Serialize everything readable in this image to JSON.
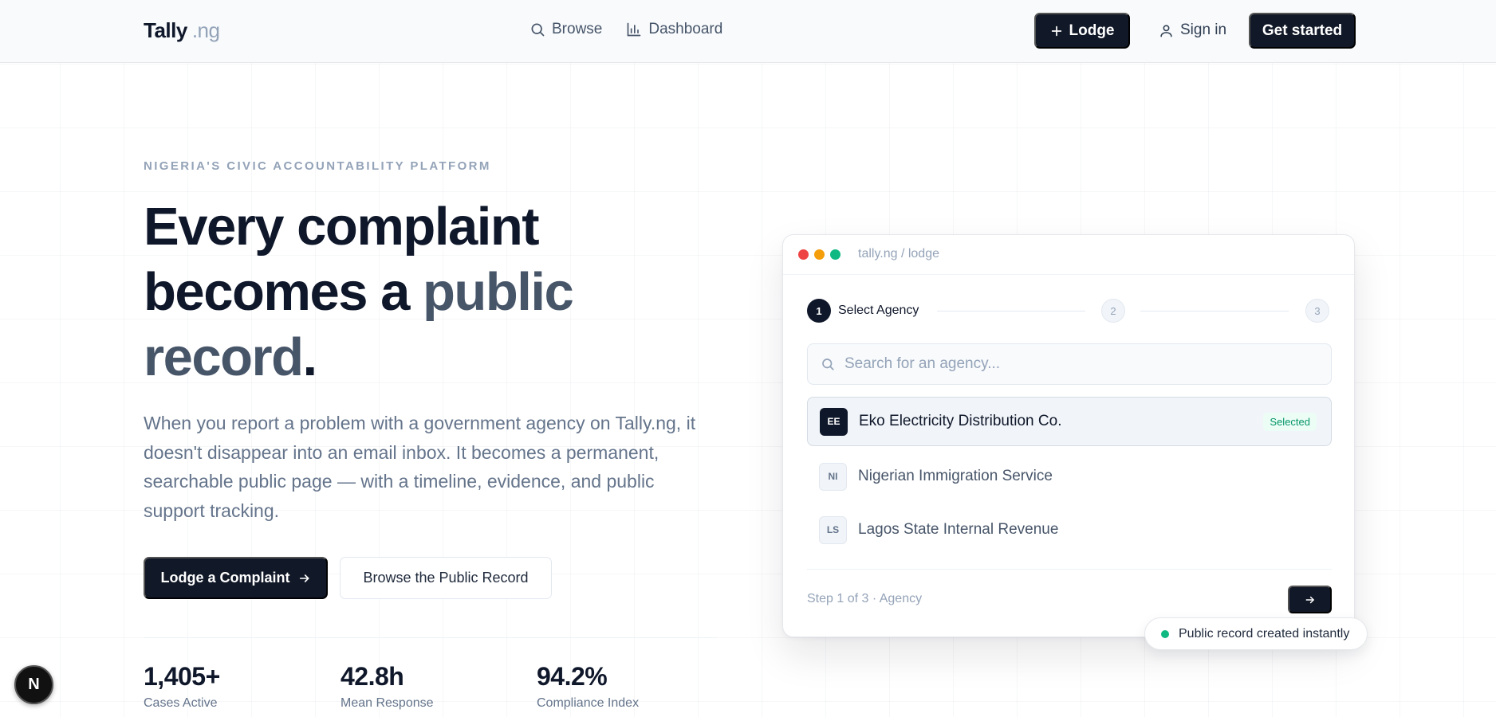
{
  "nav": {
    "brand_name": "Tally",
    "brand_tld": ".ng",
    "links": [
      {
        "label": "Browse",
        "icon": "search-icon"
      },
      {
        "label": "Dashboard",
        "icon": "bar-chart-icon"
      }
    ],
    "lodge_label": "Lodge",
    "signin_label": "Sign in",
    "get_started_label": "Get started"
  },
  "hero": {
    "eyebrow": "NIGERIA'S CIVIC ACCOUNTABILITY PLATFORM",
    "headline_line1": "Every complaint",
    "headline_line2_a": "becomes a ",
    "headline_line2_b": "public",
    "headline_line3_a": "record",
    "headline_line3_b": ".",
    "lede": "When you report a problem with a government agency on Tally.ng, it doesn't disappear into an email inbox. It becomes a permanent, searchable public page — with a timeline, evidence, and public support tracking.",
    "cta_primary": "Lodge a Complaint",
    "cta_secondary": "Browse the Public Record"
  },
  "stats": [
    {
      "value": "1,405+",
      "label": "Cases Active"
    },
    {
      "value": "42.8h",
      "label": "Mean Response"
    },
    {
      "value": "94.2%",
      "label": "Compliance Index"
    }
  ],
  "card": {
    "url": "tally.ng / lodge",
    "window_dot_colors": [
      "#ef4444",
      "#f59e0b",
      "#10b981"
    ],
    "steps": [
      {
        "number": "1",
        "label": "Select Agency"
      },
      {
        "number": "2"
      },
      {
        "number": "3"
      }
    ],
    "search_placeholder": "Search for an agency...",
    "agencies": [
      {
        "initials": "EE",
        "name": "Eko Electricity Distribution Co.",
        "tag": "Selected"
      },
      {
        "initials": "NI",
        "name": "Nigerian Immigration Service"
      },
      {
        "initials": "LS",
        "name": "Lagos State Internal Revenue"
      }
    ],
    "footer_status": "Step 1 of 3 · Agency"
  },
  "toast": {
    "label": "Public record created instantly"
  },
  "fab": {
    "label": "N"
  },
  "colors": {
    "primary": "#111827",
    "accent_green": "#10b981",
    "muted": "#64748b"
  }
}
